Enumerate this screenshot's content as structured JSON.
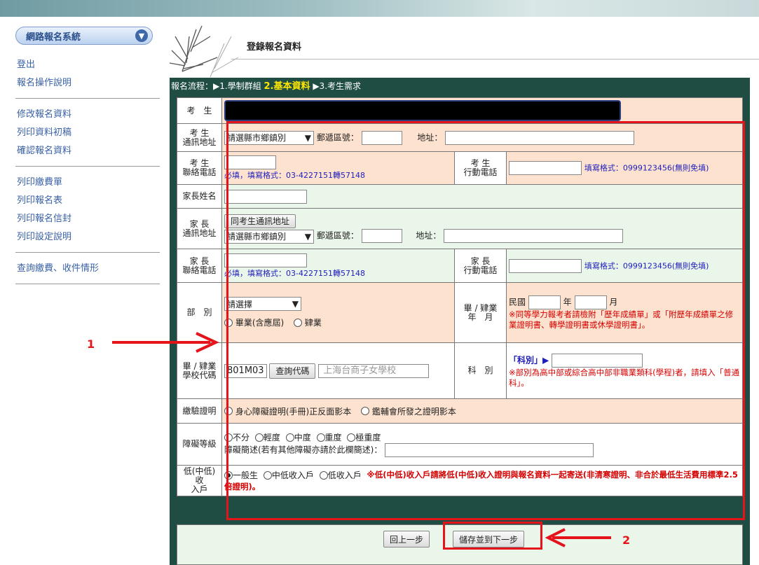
{
  "sidebar": {
    "system_label": "網路報名系統",
    "group1": [
      "登出",
      "報名操作說明"
    ],
    "group2": [
      "修改報名資料",
      "列印資料初稿",
      "確認報名資料"
    ],
    "group3": [
      "列印繳費單",
      "列印報名表",
      "列印報名信封",
      "列印設定說明"
    ],
    "group4": [
      "查詢繳費、收件情形"
    ]
  },
  "page_title": "登錄報名資料",
  "flow": {
    "prefix": "報名流程：▶1.學制群組",
    "current": "2.基本資料",
    "next": "▶3.考生需求"
  },
  "form": {
    "examinee_label": "考　生",
    "address_label": "考 生\n通訊地址",
    "county_placeholder": "請選縣市鄉鎮別",
    "zip_label": "郵遞區號：",
    "addr_label": "地址：",
    "phone_label": "考 生\n聯絡電話",
    "phone_hint": "必填，填寫格式：03-4227151轉57148",
    "mobile_label": "考 生\n行動電話",
    "mobile_hint": "填寫格式：0999123456(無則免填)",
    "parent_name_label": "家長姓名",
    "parent_addr_label": "家 長\n通訊地址",
    "same_addr_btn": "同考生通訊地址",
    "parent_phone_label": "家 長\n聯絡電話",
    "parent_mobile_label": "家 長\n行動電話",
    "dept_label": "部　別",
    "dept_select": "請選擇",
    "dept_opt1": "畢業(含應屆)",
    "dept_opt2": "肄業",
    "grad_label": "畢 / 肄業\n年　月",
    "roc_label": "民國",
    "year_label": "年",
    "month_label": "月",
    "grad_hint": "※同等學力報考者請檢附「歷年成績單」或「附歷年成績單之修業證明書、轉學證明書或休學證明書」。",
    "school_label": "畢 / 肄業\n學校代碼",
    "school_code": "801M03",
    "query_btn": "查詢代碼",
    "school_name": "上海台商子女學校",
    "subject_label": "科　別",
    "subject_prefix": "「科別」▶",
    "subject_hint": "※部別為高中部或綜合高中部非職業類科(學程)者，請填入「普通科」。",
    "proof_label": "繳驗證明",
    "proof_opt1": "身心障礙證明(手冊)正反面影本",
    "proof_opt2": "鑑輔會所發之證明影本",
    "disability_label": "障礙等級",
    "dis_opts": [
      "不分",
      "輕度",
      "中度",
      "重度",
      "極重度"
    ],
    "dis_desc": "障礙簡述(若有其他障礙亦請於此欄簡述)：",
    "income_label": "低(中低)收\n入戶",
    "income_opts": [
      "一般生",
      "中低收入戶",
      "低收入戶"
    ],
    "income_hint": "※低(中低)收入戶請將低(中低)收入證明與報名資料一起寄送(非清寒證明、非合於最低生活費用標準2.5倍證明)。"
  },
  "buttons": {
    "back": "回上一步",
    "save_next": "儲存並到下一步"
  },
  "callouts": {
    "one": "1",
    "two": "2"
  },
  "colors": {
    "accent_red": "#e5141b",
    "header_green": "#1f4d44",
    "peach": "#fde3cf",
    "green": "#eaf6e9"
  }
}
